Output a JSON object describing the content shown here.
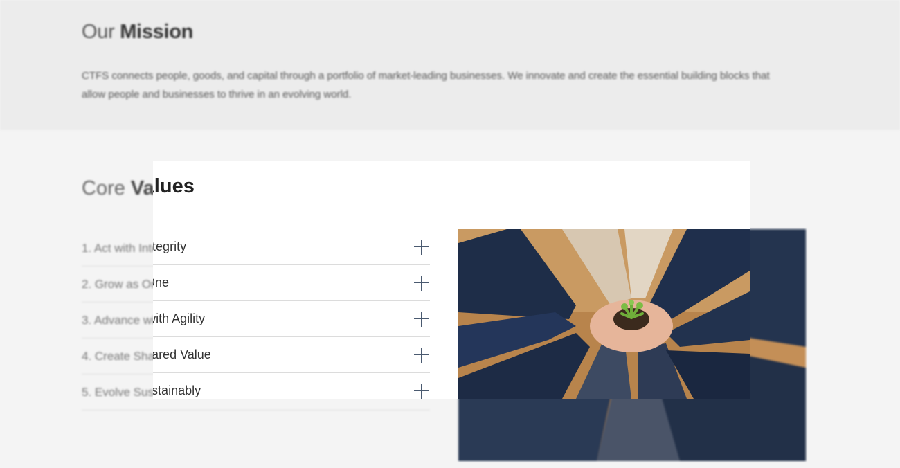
{
  "mission": {
    "title_regular": "Our ",
    "title_bold": "Mission",
    "text": "CTFS connects people, goods, and capital through a portfolio of market-leading businesses. We innovate and create the essential building blocks that allow people and businesses to thrive in an evolving world."
  },
  "core_values": {
    "title_regular": "Core ",
    "title_bold": "Values",
    "items": [
      {
        "label": "1. Act with Integrity",
        "icon": "plus-icon"
      },
      {
        "label": "2. Grow as One",
        "icon": "plus-icon"
      },
      {
        "label": "3. Advance with Agility",
        "icon": "plus-icon"
      },
      {
        "label": "4. Create Shared Value",
        "icon": "plus-icon"
      },
      {
        "label": "5. Evolve Sustainably",
        "icon": "plus-icon"
      }
    ],
    "image_alt": "Hands together holding a seedling"
  },
  "colors": {
    "panel_bg": "#ffffff",
    "page_bg": "#f4f4f4",
    "mission_bg": "#ececec",
    "icon": "#4a5a70"
  }
}
